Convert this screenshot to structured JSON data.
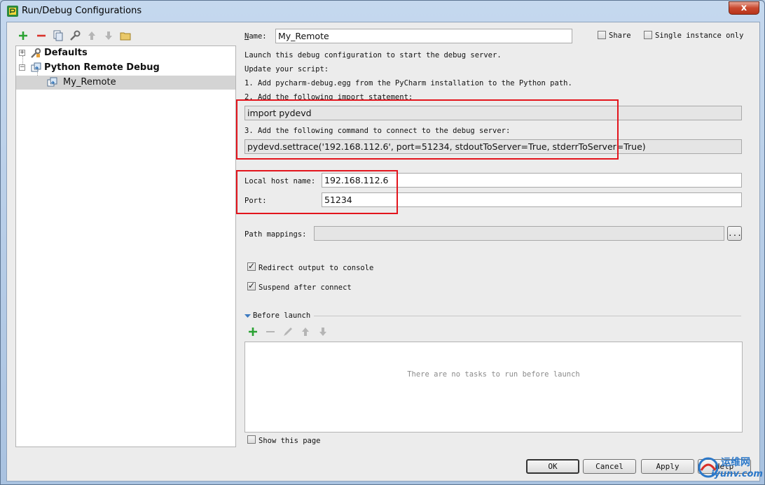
{
  "window": {
    "title": "Run/Debug Configurations",
    "close_label": "x"
  },
  "tree": {
    "items": [
      {
        "label": "Defaults",
        "bold": true
      },
      {
        "label": "Python Remote Debug",
        "bold": true
      },
      {
        "label": "My_Remote",
        "bold": false,
        "selected": true
      }
    ]
  },
  "form": {
    "name_label": "Name:",
    "name_value": "My_Remote",
    "share_label": "Share",
    "single_instance_label": "Single instance only",
    "instructions": [
      "Launch this debug configuration to start the debug server.",
      "Update your script:",
      "1. Add pycharm-debug.egg from the PyCharm installation to the Python path.",
      "2. Add the following import statement:"
    ],
    "import_statement": "import pydevd",
    "step3": "3. Add the following command to connect to the debug server:",
    "settrace_command": "pydevd.settrace('192.168.112.6', port=51234, stdoutToServer=True, stderrToServer=True)",
    "local_host_label": "Local host name:",
    "local_host_value": "192.168.112.6",
    "port_label": "Port:",
    "port_value": "51234",
    "path_mappings_label": "Path mappings:",
    "browse_label": "...",
    "redirect_label": "Redirect output to console",
    "redirect_checked": true,
    "suspend_label": "Suspend after connect",
    "suspend_checked": true,
    "before_launch_label": "Before launch",
    "no_tasks_text": "There are no tasks to run before launch",
    "show_page_label": "Show this page"
  },
  "buttons": {
    "ok": "OK",
    "cancel": "Cancel",
    "apply": "Apply",
    "help": "Help"
  },
  "watermark": {
    "cn": "运维网",
    "en": "iyunv.com"
  },
  "colors": {
    "highlight_red": "#e3141c",
    "add_green": "#2aa232",
    "remove_red": "#d9322a"
  }
}
